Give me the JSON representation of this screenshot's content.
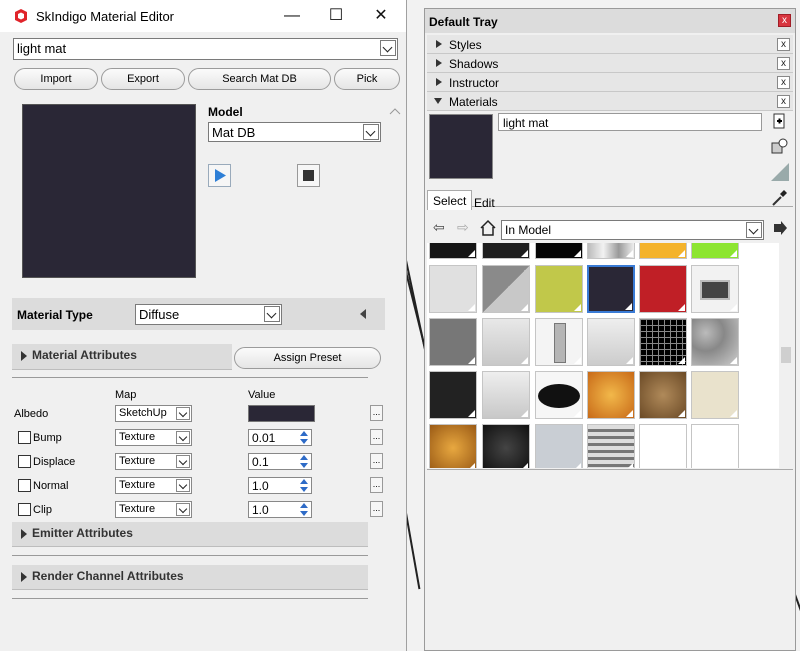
{
  "editor": {
    "title": "SkIndigo Material Editor",
    "window_controls": {
      "minimize": "—",
      "maximize": "☐",
      "close": "✕"
    },
    "material_select": "light mat",
    "buttons": {
      "import": "Import",
      "export": "Export",
      "search": "Search Mat DB",
      "pick": "Pick"
    },
    "model_label": "Model",
    "model_select": "Mat DB",
    "material_type_label": "Material Type",
    "material_type_value": "Diffuse",
    "material_attributes": "Material Attributes",
    "assign_preset": "Assign Preset",
    "map_header": "Map",
    "value_header": "Value",
    "rows": [
      {
        "label": "Albedo",
        "map": "SketchUp",
        "value": "",
        "checkbox": false,
        "dots": "..."
      },
      {
        "label": "Bump",
        "map": "Texture",
        "value": "0.01",
        "checkbox": true,
        "dots": "..."
      },
      {
        "label": "Displace",
        "map": "Texture",
        "value": "0.1",
        "checkbox": true,
        "dots": "..."
      },
      {
        "label": "Normal",
        "map": "Texture",
        "value": "1.0",
        "checkbox": true,
        "dots": "..."
      },
      {
        "label": "Clip",
        "map": "Texture",
        "value": "1.0",
        "checkbox": true,
        "dots": "..."
      }
    ],
    "emitter_attributes": "Emitter Attributes",
    "render_channel_attributes": "Render Channel Attributes",
    "preview_color": "#2a2736"
  },
  "tray": {
    "title": "Default Tray",
    "panels": [
      "Styles",
      "Shadows",
      "Instructor",
      "Materials"
    ],
    "material_name": "light mat",
    "tabs": {
      "select": "Select",
      "edit": "Edit"
    },
    "collection_select": "In Model",
    "close_glyph": "x"
  }
}
